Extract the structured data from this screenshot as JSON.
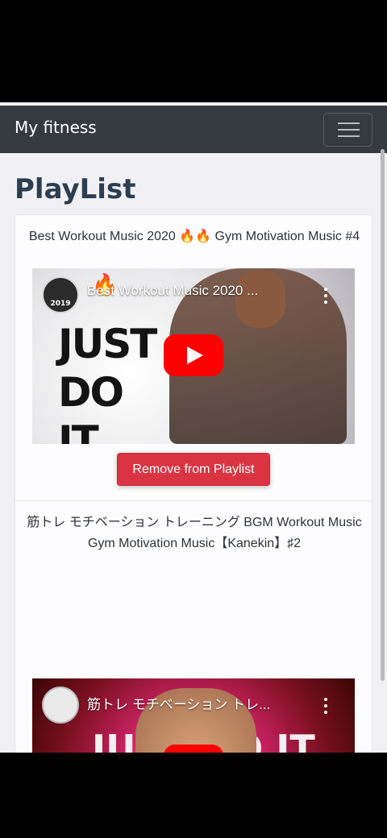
{
  "app": {
    "brand": "My fitness"
  },
  "page": {
    "title": "PlayList"
  },
  "playlist": [
    {
      "title": "Best Workout Music 2020 🔥🔥 Gym Motivation Music #4",
      "video_overlay_title": "Best Workout Music 2020 ...",
      "thumbnail_text": [
        "JUST",
        "DO",
        "IT."
      ],
      "channel_badge": "2019",
      "remove_label": "Remove from Playlist"
    },
    {
      "title": "筋トレ モチベーション トレーニング BGM Workout Music Gym Motivation Music【Kanekin】♯2",
      "video_overlay_title": "筋トレ モチベーション トレ...",
      "thumbnail_text": "JUST DO IT."
    }
  ],
  "colors": {
    "navbar": "#343a40",
    "danger": "#da3443",
    "youtube_red": "#ff0000"
  },
  "icons": {
    "menu": "hamburger-menu-icon",
    "play": "youtube-play-icon",
    "more": "more-vertical-icon"
  }
}
